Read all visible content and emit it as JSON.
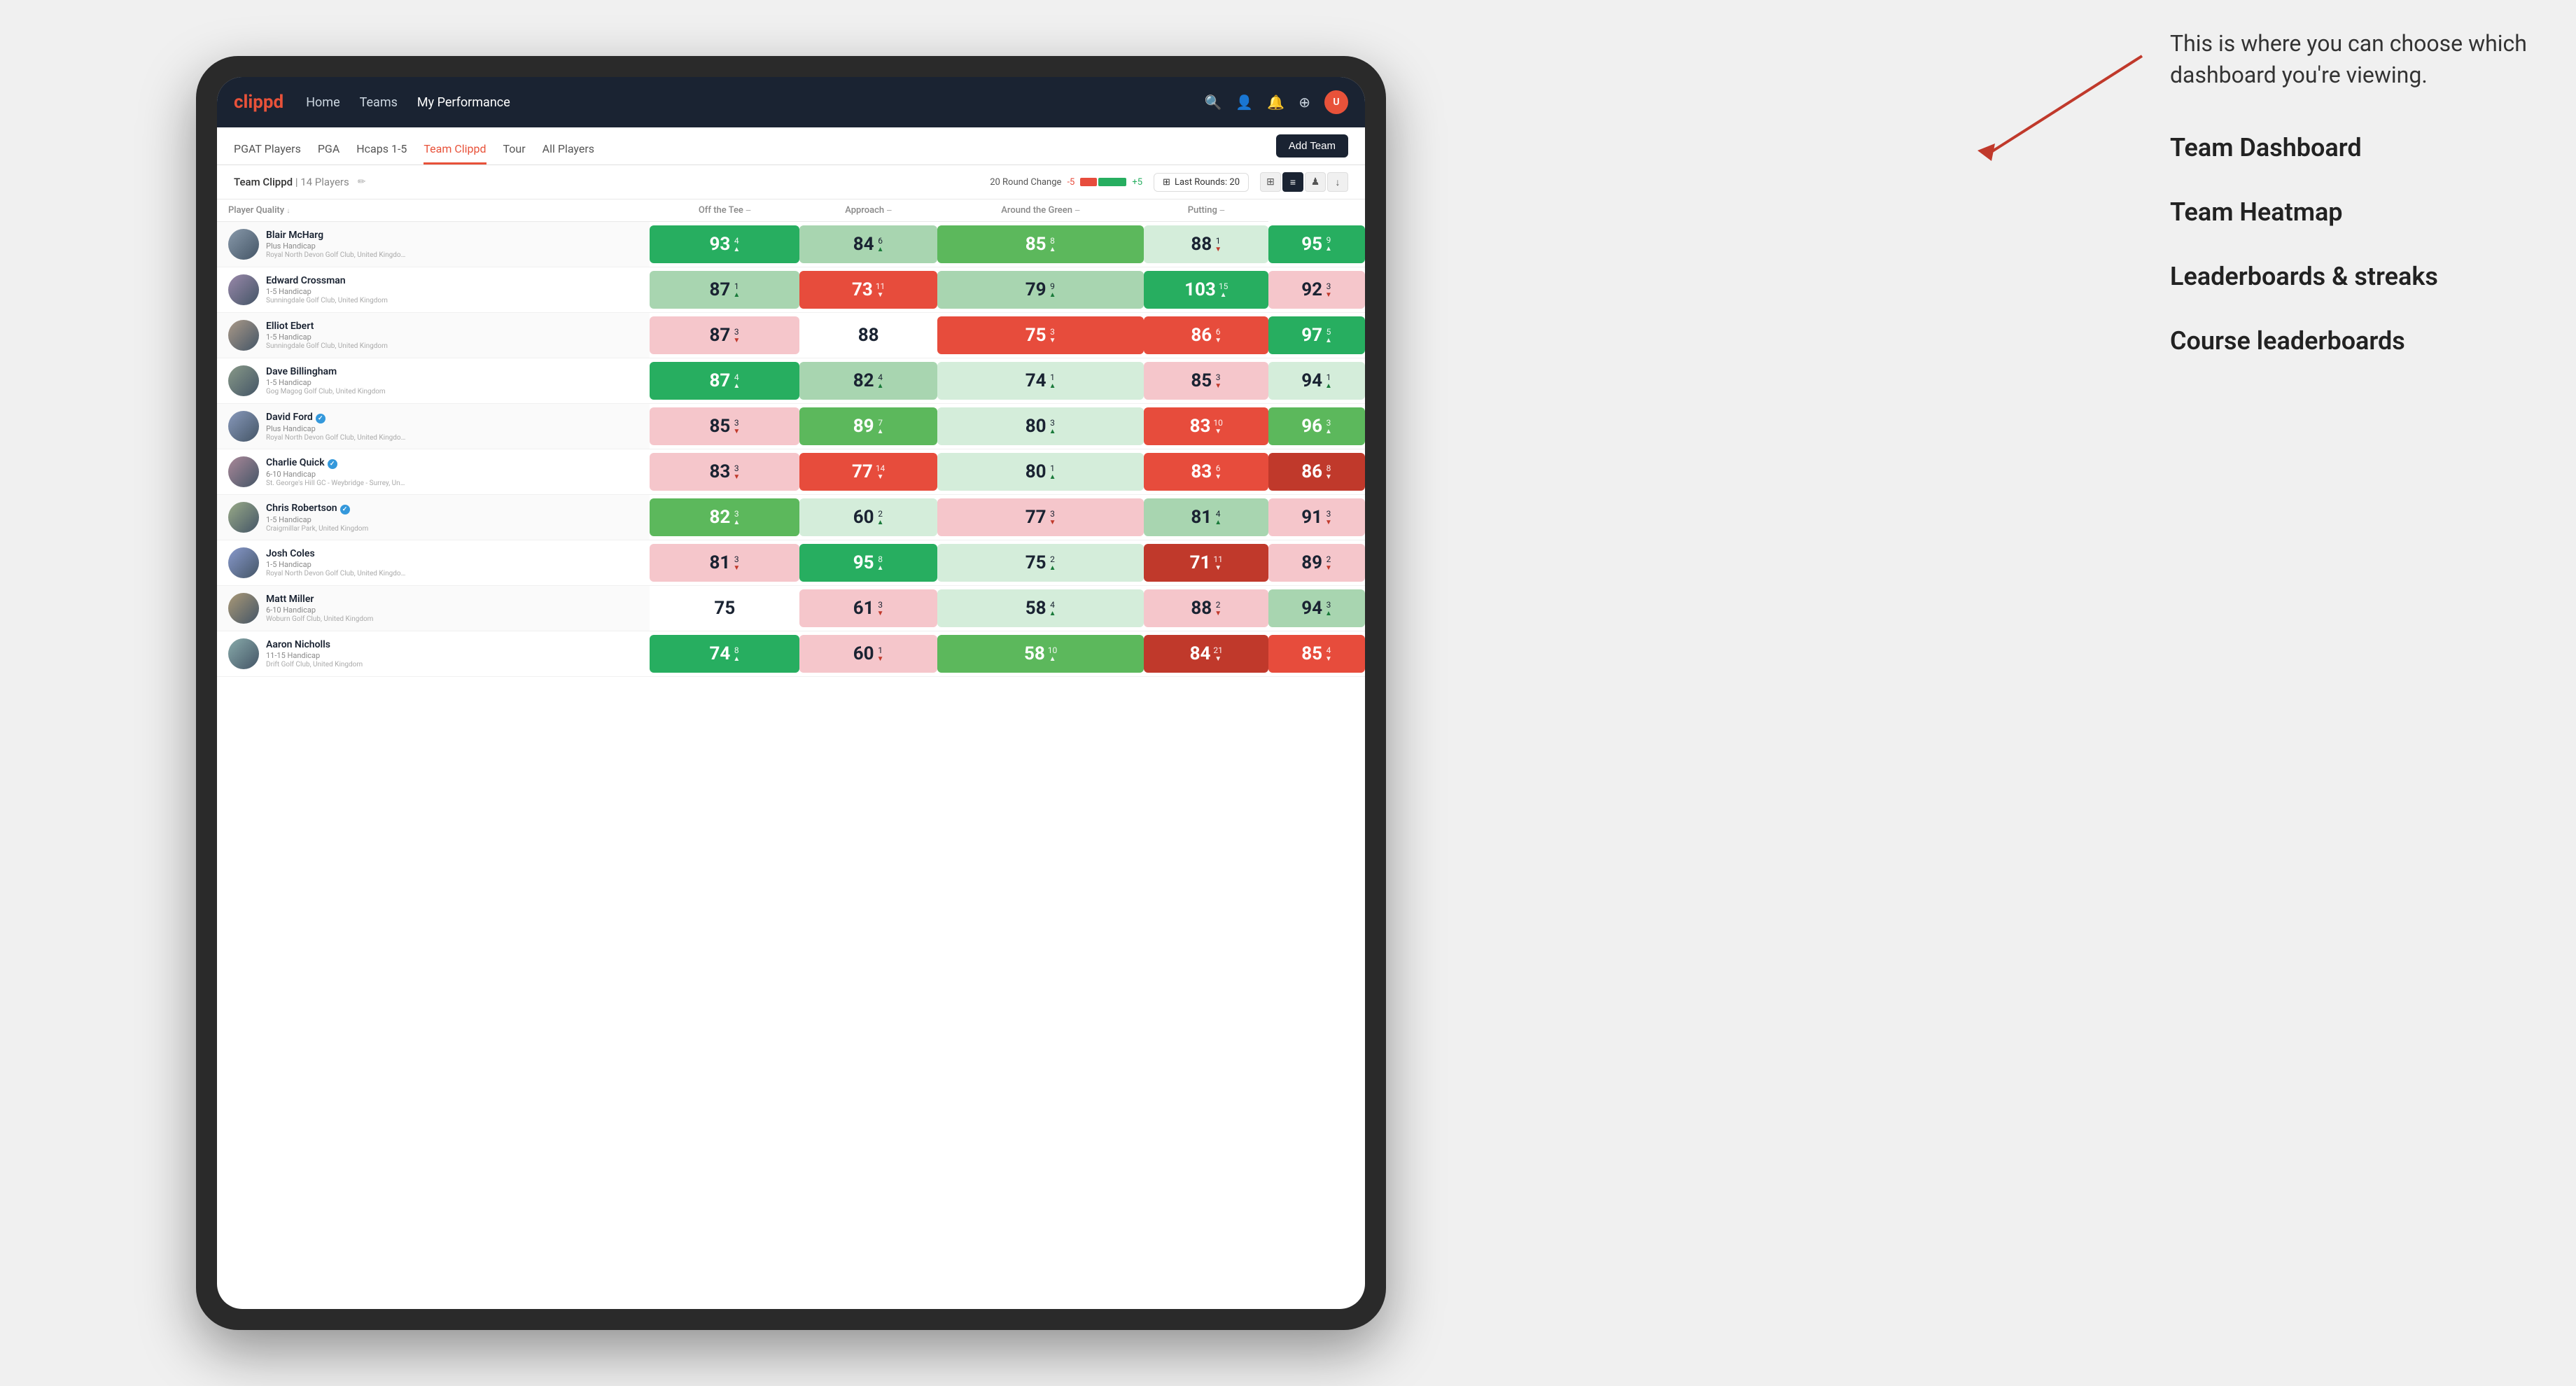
{
  "annotation": {
    "bubble_text": "This is where you can choose which dashboard you're viewing.",
    "items": [
      "Team Dashboard",
      "Team Heatmap",
      "Leaderboards & streaks",
      "Course leaderboards"
    ]
  },
  "nav": {
    "logo": "clippd",
    "links": [
      "Home",
      "Teams",
      "My Performance"
    ],
    "active_link": "My Performance",
    "icon_search": "🔍",
    "icon_person": "👤",
    "icon_bell": "🔔",
    "icon_settings": "⊕",
    "avatar_initials": "U"
  },
  "sub_nav": {
    "tabs": [
      "PGAT Players",
      "PGA",
      "Hcaps 1-5",
      "Team Clippd",
      "Tour",
      "All Players"
    ],
    "active_tab": "Team Clippd",
    "add_team_label": "Add Team"
  },
  "toolbar": {
    "team_name": "Team Clippd",
    "player_count": "14 Players",
    "round_change_label": "20 Round Change",
    "change_value_negative": "-5",
    "change_value_positive": "+5",
    "last_rounds_label": "Last Rounds:",
    "last_rounds_value": "20"
  },
  "table": {
    "headers": {
      "player": "Player Quality ↓",
      "off_tee": "Off the Tee —",
      "approach": "Approach —",
      "around_green": "Around the Green —",
      "putting": "Putting —"
    },
    "rows": [
      {
        "name": "Blair McHarg",
        "handicap": "Plus Handicap",
        "club": "Royal North Devon Golf Club, United Kingdom",
        "verified": false,
        "scores": {
          "quality": {
            "val": "93",
            "change": "4",
            "dir": "up",
            "heat": "heat-strong-green"
          },
          "off_tee": {
            "val": "84",
            "change": "6",
            "dir": "up",
            "heat": "heat-light-green"
          },
          "approach": {
            "val": "85",
            "change": "8",
            "dir": "up",
            "heat": "heat-green"
          },
          "around_green": {
            "val": "88",
            "change": "1",
            "dir": "down",
            "heat": "heat-very-light-green"
          },
          "putting": {
            "val": "95",
            "change": "9",
            "dir": "up",
            "heat": "heat-strong-green"
          }
        }
      },
      {
        "name": "Edward Crossman",
        "handicap": "1-5 Handicap",
        "club": "Sunningdale Golf Club, United Kingdom",
        "verified": false,
        "scores": {
          "quality": {
            "val": "87",
            "change": "1",
            "dir": "up",
            "heat": "heat-light-green"
          },
          "off_tee": {
            "val": "73",
            "change": "11",
            "dir": "down",
            "heat": "heat-red"
          },
          "approach": {
            "val": "79",
            "change": "9",
            "dir": "up",
            "heat": "heat-light-green"
          },
          "around_green": {
            "val": "103",
            "change": "15",
            "dir": "up",
            "heat": "heat-strong-green"
          },
          "putting": {
            "val": "92",
            "change": "3",
            "dir": "down",
            "heat": "heat-light-red"
          }
        }
      },
      {
        "name": "Elliot Ebert",
        "handicap": "1-5 Handicap",
        "club": "Sunningdale Golf Club, United Kingdom",
        "verified": false,
        "scores": {
          "quality": {
            "val": "87",
            "change": "3",
            "dir": "down",
            "heat": "heat-light-red"
          },
          "off_tee": {
            "val": "88",
            "change": "",
            "dir": "none",
            "heat": "heat-neutral"
          },
          "approach": {
            "val": "75",
            "change": "3",
            "dir": "down",
            "heat": "heat-red"
          },
          "around_green": {
            "val": "86",
            "change": "6",
            "dir": "down",
            "heat": "heat-red"
          },
          "putting": {
            "val": "97",
            "change": "5",
            "dir": "up",
            "heat": "heat-strong-green"
          }
        }
      },
      {
        "name": "Dave Billingham",
        "handicap": "1-5 Handicap",
        "club": "Gog Magog Golf Club, United Kingdom",
        "verified": false,
        "scores": {
          "quality": {
            "val": "87",
            "change": "4",
            "dir": "up",
            "heat": "heat-strong-green"
          },
          "off_tee": {
            "val": "82",
            "change": "4",
            "dir": "up",
            "heat": "heat-light-green"
          },
          "approach": {
            "val": "74",
            "change": "1",
            "dir": "up",
            "heat": "heat-very-light-green"
          },
          "around_green": {
            "val": "85",
            "change": "3",
            "dir": "down",
            "heat": "heat-light-red"
          },
          "putting": {
            "val": "94",
            "change": "1",
            "dir": "up",
            "heat": "heat-very-light-green"
          }
        }
      },
      {
        "name": "David Ford",
        "handicap": "Plus Handicap",
        "club": "Royal North Devon Golf Club, United Kingdom",
        "verified": true,
        "scores": {
          "quality": {
            "val": "85",
            "change": "3",
            "dir": "down",
            "heat": "heat-light-red"
          },
          "off_tee": {
            "val": "89",
            "change": "7",
            "dir": "up",
            "heat": "heat-green"
          },
          "approach": {
            "val": "80",
            "change": "3",
            "dir": "up",
            "heat": "heat-very-light-green"
          },
          "around_green": {
            "val": "83",
            "change": "10",
            "dir": "down",
            "heat": "heat-red"
          },
          "putting": {
            "val": "96",
            "change": "3",
            "dir": "up",
            "heat": "heat-green"
          }
        }
      },
      {
        "name": "Charlie Quick",
        "handicap": "6-10 Handicap",
        "club": "St. George's Hill GC - Weybridge - Surrey, Uni...",
        "verified": true,
        "scores": {
          "quality": {
            "val": "83",
            "change": "3",
            "dir": "down",
            "heat": "heat-light-red"
          },
          "off_tee": {
            "val": "77",
            "change": "14",
            "dir": "down",
            "heat": "heat-red"
          },
          "approach": {
            "val": "80",
            "change": "1",
            "dir": "up",
            "heat": "heat-very-light-green"
          },
          "around_green": {
            "val": "83",
            "change": "6",
            "dir": "down",
            "heat": "heat-red"
          },
          "putting": {
            "val": "86",
            "change": "8",
            "dir": "down",
            "heat": "heat-strong-red"
          }
        }
      },
      {
        "name": "Chris Robertson",
        "handicap": "1-5 Handicap",
        "club": "Craigmillar Park, United Kingdom",
        "verified": true,
        "scores": {
          "quality": {
            "val": "82",
            "change": "3",
            "dir": "up",
            "heat": "heat-green"
          },
          "off_tee": {
            "val": "60",
            "change": "2",
            "dir": "up",
            "heat": "heat-very-light-green"
          },
          "approach": {
            "val": "77",
            "change": "3",
            "dir": "down",
            "heat": "heat-light-red"
          },
          "around_green": {
            "val": "81",
            "change": "4",
            "dir": "up",
            "heat": "heat-light-green"
          },
          "putting": {
            "val": "91",
            "change": "3",
            "dir": "down",
            "heat": "heat-light-red"
          }
        }
      },
      {
        "name": "Josh Coles",
        "handicap": "1-5 Handicap",
        "club": "Royal North Devon Golf Club, United Kingdom",
        "verified": false,
        "scores": {
          "quality": {
            "val": "81",
            "change": "3",
            "dir": "down",
            "heat": "heat-light-red"
          },
          "off_tee": {
            "val": "95",
            "change": "8",
            "dir": "up",
            "heat": "heat-strong-green"
          },
          "approach": {
            "val": "75",
            "change": "2",
            "dir": "up",
            "heat": "heat-very-light-green"
          },
          "around_green": {
            "val": "71",
            "change": "11",
            "dir": "down",
            "heat": "heat-strong-red"
          },
          "putting": {
            "val": "89",
            "change": "2",
            "dir": "down",
            "heat": "heat-light-red"
          }
        }
      },
      {
        "name": "Matt Miller",
        "handicap": "6-10 Handicap",
        "club": "Woburn Golf Club, United Kingdom",
        "verified": false,
        "scores": {
          "quality": {
            "val": "75",
            "change": "",
            "dir": "none",
            "heat": "heat-neutral"
          },
          "off_tee": {
            "val": "61",
            "change": "3",
            "dir": "down",
            "heat": "heat-light-red"
          },
          "approach": {
            "val": "58",
            "change": "4",
            "dir": "up",
            "heat": "heat-very-light-green"
          },
          "around_green": {
            "val": "88",
            "change": "2",
            "dir": "down",
            "heat": "heat-light-red"
          },
          "putting": {
            "val": "94",
            "change": "3",
            "dir": "up",
            "heat": "heat-light-green"
          }
        }
      },
      {
        "name": "Aaron Nicholls",
        "handicap": "11-15 Handicap",
        "club": "Drift Golf Club, United Kingdom",
        "verified": false,
        "scores": {
          "quality": {
            "val": "74",
            "change": "8",
            "dir": "up",
            "heat": "heat-strong-green"
          },
          "off_tee": {
            "val": "60",
            "change": "1",
            "dir": "down",
            "heat": "heat-light-red"
          },
          "approach": {
            "val": "58",
            "change": "10",
            "dir": "up",
            "heat": "heat-green"
          },
          "around_green": {
            "val": "84",
            "change": "21",
            "dir": "down",
            "heat": "heat-strong-red"
          },
          "putting": {
            "val": "85",
            "change": "4",
            "dir": "down",
            "heat": "heat-red"
          }
        }
      }
    ]
  }
}
